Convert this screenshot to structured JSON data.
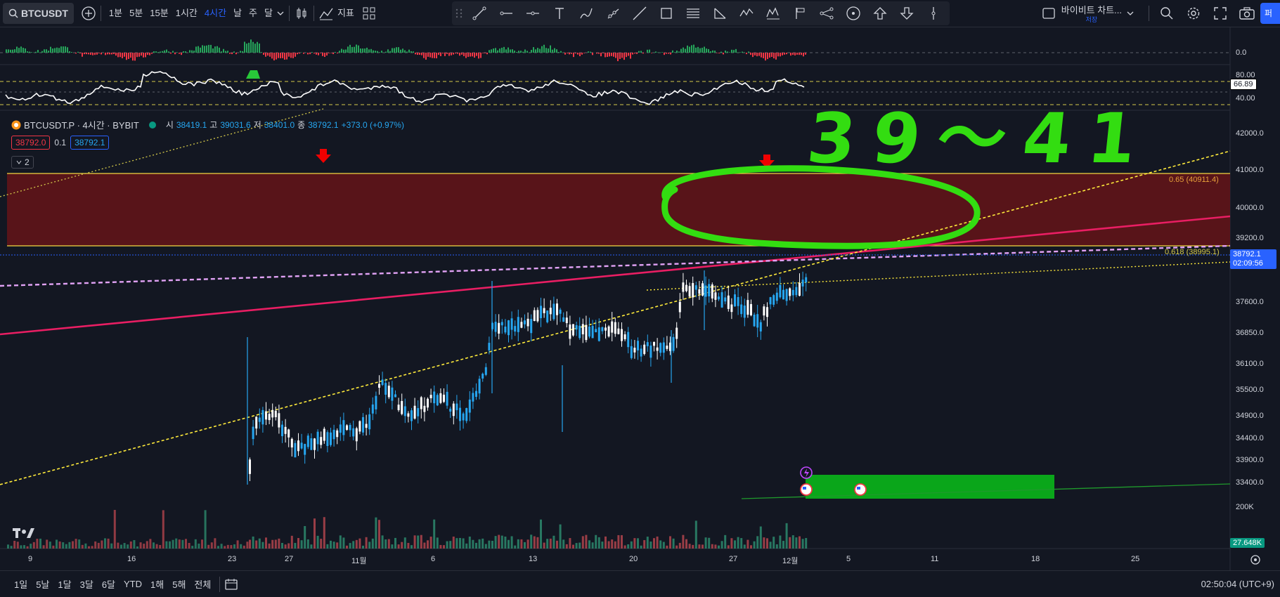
{
  "toolbar": {
    "symbol": "BTCUSDT",
    "intervals": [
      "1분",
      "5분",
      "15분",
      "1시간",
      "4시간",
      "날",
      "주",
      "달"
    ],
    "active_interval": "4시간",
    "indicators_label": "지표",
    "layout_name": "바이비트 차트...",
    "layout_sub": "저장",
    "publish_label": "퍼블"
  },
  "legend": {
    "title": "BTCUSDT.P · 4시간 · BYBIT",
    "open_label": "시",
    "open": "38419.1",
    "high_label": "고",
    "high": "39031.6",
    "low_label": "저",
    "low": "38401.0",
    "close_label": "종",
    "close": "38792.1",
    "change": "+373.0 (+0.97%)",
    "bid": "38792.0",
    "spread": "0.1",
    "ask": "38792.1",
    "collapse_count": "2"
  },
  "annotation_text": "39～41",
  "price_axis": {
    "labels": [
      "42000.0",
      "41000.0",
      "40000.0",
      "39200.0",
      "37600.0",
      "36850.0",
      "36100.0",
      "35500.0",
      "34900.0",
      "34400.0",
      "33900.0",
      "33400.0"
    ],
    "osc1_zero": "0.0",
    "osc2_top": "80.00",
    "osc2_value": "66.89",
    "osc2_bottom": "40.00",
    "last_price": "38792.1",
    "countdown": "02:09:56",
    "volume_scale": "200K",
    "volume_value": "27.648K"
  },
  "fib": {
    "upper": "0.65 (40911.4)",
    "lower": "0.618 (38995.1)"
  },
  "time_axis": [
    "9",
    "16",
    "23",
    "27",
    "11월",
    "6",
    "13",
    "20",
    "27",
    "12월",
    "5",
    "11",
    "18",
    "25"
  ],
  "bottom": {
    "ranges": [
      "1일",
      "5날",
      "1달",
      "3달",
      "6달",
      "YTD",
      "1해",
      "5해",
      "전체"
    ],
    "clock": "02:50:04 (UTC+9)"
  },
  "colors": {
    "background": "#131722",
    "zone_fill": "#5c1419",
    "zone_line": "#f5d742",
    "trend_red": "#e91e63",
    "trend_yellow": "#ffeb3b",
    "trend_violet": "#e1a2f5",
    "up": "#26a6f0",
    "down": "#ffffff",
    "marker_green": "#33dd11",
    "accent": "#2962ff"
  }
}
